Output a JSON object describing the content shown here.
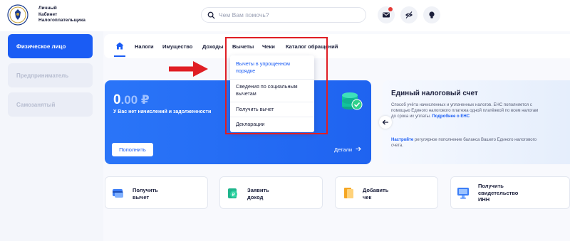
{
  "header": {
    "logo_lines": [
      "Личный",
      "Кабинет",
      "Налогоплательщика"
    ],
    "search_placeholder": "Чем Вам помочь?"
  },
  "sidebar": {
    "items": [
      {
        "label": "Физическое лицо",
        "active": true
      },
      {
        "label": "Предприниматель",
        "active": false
      },
      {
        "label": "Самозанятый",
        "active": false
      }
    ]
  },
  "nav": {
    "items": [
      "Налоги",
      "Имущество",
      "Доходы",
      "Вычеты",
      "Чеки",
      "Каталог обращений"
    ]
  },
  "dropdown": {
    "items": [
      "Вычеты в упрощенном порядке",
      "Сведения по социальным вычетам",
      "Получить вычет",
      "Декларации"
    ]
  },
  "balance_card": {
    "amount_int": "0",
    "amount_dec": ".00 ₽",
    "subtitle": "У Вас нет начислений и задолженности",
    "pay_button": "Пополнить",
    "details_link": "Детали"
  },
  "ens_card": {
    "title": "Единый налоговый счет",
    "text": "Способ учёта начисленных и уплаченных налогов. ЕНС пополняется с помощью Единого налогового платежа одной платёжкой по всем налогам до срока их уплаты.",
    "more_link": "Подробнее о ЕНС",
    "setup_link": "Настройте",
    "setup_text": "регулярное пополнение баланса Вашего Единого налогового счета."
  },
  "tiles": [
    {
      "lines": [
        "Получить",
        "вычет"
      ]
    },
    {
      "lines": [
        "Заявить",
        "доход"
      ]
    },
    {
      "lines": [
        "Добавить",
        "чек"
      ]
    },
    {
      "lines": [
        "Получить",
        "свидетельство",
        "ИНН"
      ]
    }
  ],
  "colors": {
    "brand_blue": "#1a5cf4",
    "annotation_red": "#e01e24",
    "notification_red": "#e53935"
  },
  "icons": [
    "search-icon",
    "mail-icon",
    "eye-off-icon",
    "lightbulb-icon",
    "home-icon",
    "coins-icon",
    "check-icon",
    "arrow-left-icon",
    "arrow-right-icon"
  ]
}
